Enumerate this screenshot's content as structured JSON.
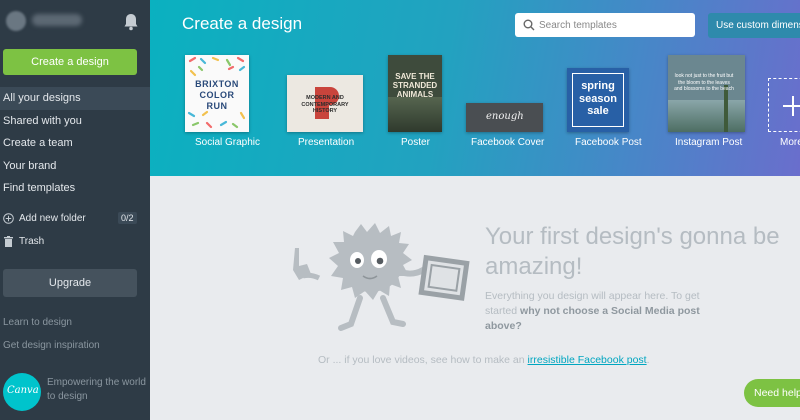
{
  "sidebar": {
    "create_label": "Create a design",
    "nav": [
      {
        "label": "All your designs",
        "active": true
      },
      {
        "label": "Shared with you"
      },
      {
        "label": "Create a team"
      },
      {
        "label": "Your brand"
      },
      {
        "label": "Find templates"
      }
    ],
    "folder_label": "Add new folder",
    "folder_count": "0/2",
    "trash_label": "Trash",
    "upgrade_label": "Upgrade",
    "learn_label": "Learn to design",
    "inspiration_label": "Get design inspiration",
    "logo_text": "Canva",
    "tagline": "Empowering the world to design"
  },
  "header": {
    "title": "Create a design",
    "search_placeholder": "Search templates",
    "custom_label": "Use custom dimensions",
    "tiles": [
      {
        "label": "Social Graphic",
        "thumb_text": "BRIXTON COLOR RUN"
      },
      {
        "label": "Presentation",
        "thumb_text": "MODERN AND CONTEMPORARY HISTORY"
      },
      {
        "label": "Poster",
        "thumb_text": "SAVE THE STRANDED ANIMALS"
      },
      {
        "label": "Facebook Cover",
        "thumb_text": "enough"
      },
      {
        "label": "Facebook Post",
        "thumb_text": "spring season sale"
      },
      {
        "label": "Instagram Post",
        "thumb_text": "look not just to the fruit but the bloom to the leaves and blossoms to the beach"
      },
      {
        "label": "More"
      }
    ]
  },
  "main": {
    "title": "Your first design's gonna be amazing!",
    "desc_start": "Everything you design will appear here. To get started ",
    "desc_bold": "why not choose a Social Media post above?",
    "video_prefix": "Or ... if you love videos, see how to make an ",
    "video_link": "irresistible Facebook post",
    "video_suffix": ".",
    "help_label": "Need help"
  },
  "colors": {
    "sidebar_bg": "#2e3b46",
    "accent_green": "#7dc243",
    "header_teal": "#0ab1c0",
    "header_purple": "#6a6ecc",
    "link": "#00a6c0"
  }
}
